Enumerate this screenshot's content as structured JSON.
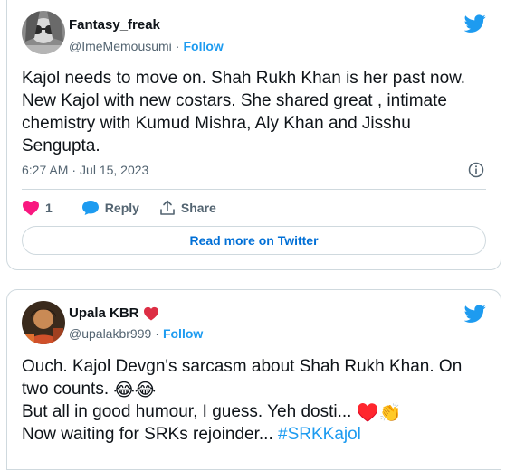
{
  "tweets": [
    {
      "author_name": "Fantasy_freak",
      "handle": "@ImeMemousumi",
      "separator": "·",
      "follow_label": "Follow",
      "text_lines": [
        "Kajol needs to move on. Shah Rukh Khan is her past now.",
        "New Kajol with new costars. She shared great , intimate",
        "chemistry with Kumud Mishra, Aly Khan and Jisshu",
        "Sengupta."
      ],
      "time": "6:27 AM",
      "date": "Jul 15, 2023",
      "like_count": "1",
      "reply_label": "Reply",
      "share_label": "Share",
      "read_more_label": "Read more on Twitter"
    },
    {
      "author_name": "Upala KBR",
      "author_badge": "❤️",
      "handle": "@upalakbr999",
      "separator": "·",
      "follow_label": "Follow",
      "line1": "Ouch. Kajol Devgn's sarcasm about Shah Rukh Khan. On",
      "line2": "two counts.",
      "line2_emoji": "😂😂",
      "line3": "But all in good humour, I guess. Yeh dosti...",
      "line3_emoji": "♥️👏",
      "line4": "Now waiting for SRKs rejoinder...",
      "hashtag": "#SRKKajol"
    }
  ],
  "colors": {
    "accent": "#1d9bf0",
    "like": "#f91880",
    "muted": "#536471",
    "border": "#cfd9de"
  }
}
